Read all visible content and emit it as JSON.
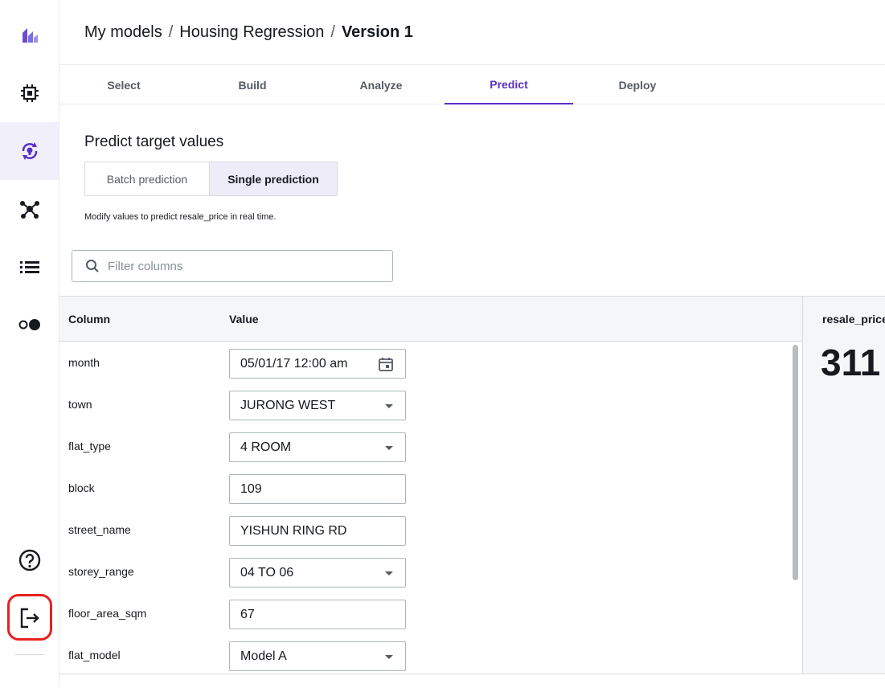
{
  "sidebar": {
    "items": [
      {
        "icon": "logo-icon"
      },
      {
        "icon": "chip-icon"
      },
      {
        "icon": "refresh-bulb-icon",
        "active": true
      },
      {
        "icon": "network-icon"
      },
      {
        "icon": "list-icon"
      },
      {
        "icon": "toggle-icon"
      },
      {
        "icon": "help-icon"
      },
      {
        "icon": "logout-icon"
      }
    ]
  },
  "breadcrumb": {
    "item1": "My models",
    "item2": "Housing Regression",
    "current": "Version 1",
    "separator": "/"
  },
  "tabs": [
    "Select",
    "Build",
    "Analyze",
    "Predict",
    "Deploy"
  ],
  "active_tab": "Predict",
  "predict": {
    "title": "Predict target values",
    "batch_label": "Batch prediction",
    "single_label": "Single prediction",
    "helper": "Modify values to predict resale_price in real time.",
    "filter_placeholder": "Filter columns"
  },
  "table": {
    "col_header": "Column",
    "value_header": "Value",
    "rows": [
      {
        "column": "month",
        "value": "05/01/17 12:00 am",
        "type": "date"
      },
      {
        "column": "town",
        "value": "JURONG WEST",
        "type": "select"
      },
      {
        "column": "flat_type",
        "value": "4 ROOM",
        "type": "select"
      },
      {
        "column": "block",
        "value": "109",
        "type": "text"
      },
      {
        "column": "street_name",
        "value": "YISHUN RING RD",
        "type": "text"
      },
      {
        "column": "storey_range",
        "value": "04 TO 06",
        "type": "select"
      },
      {
        "column": "floor_area_sqm",
        "value": "67",
        "type": "text"
      },
      {
        "column": "flat_model",
        "value": "Model A",
        "type": "select"
      }
    ]
  },
  "result": {
    "label": "resale_price",
    "value": "311"
  },
  "colors": {
    "accent": "#5a2ec8",
    "highlight_ring": "#e8211e"
  }
}
